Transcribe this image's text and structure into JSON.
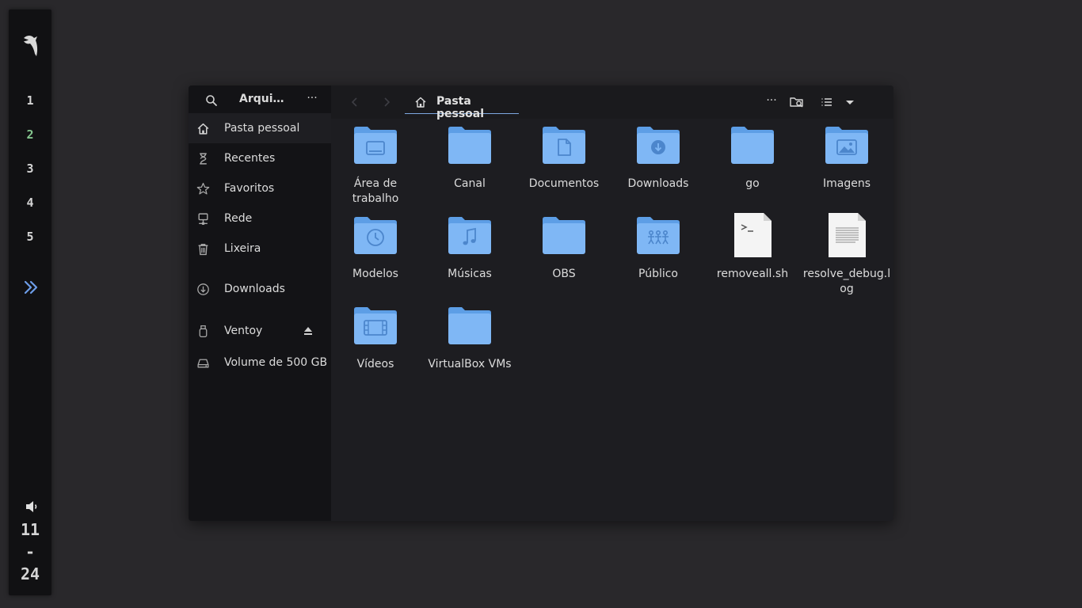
{
  "panel": {
    "workspaces": [
      "1",
      "2",
      "3",
      "4",
      "5"
    ],
    "active_workspace": "2",
    "clock": {
      "hour": "11",
      "sep": "-",
      "minute": "24"
    }
  },
  "window": {
    "sidebar": {
      "title": "Arqui…",
      "menu_label": "···",
      "places": [
        {
          "label": "Pasta pessoal",
          "icon": "home-icon",
          "selected": true
        },
        {
          "label": "Recentes",
          "icon": "hourglass-icon"
        },
        {
          "label": "Favoritos",
          "icon": "star-icon"
        },
        {
          "label": "Rede",
          "icon": "network-icon"
        },
        {
          "label": "Lixeira",
          "icon": "trash-icon"
        }
      ],
      "bookmarks": [
        {
          "label": "Downloads",
          "icon": "download-icon"
        }
      ],
      "devices": [
        {
          "label": "Ventoy",
          "icon": "usb-drive-icon",
          "ejectable": true
        },
        {
          "label": "Volume de 500 GB",
          "icon": "disk-icon"
        }
      ]
    },
    "header": {
      "location": "Pasta pessoal",
      "menu_label": "···"
    },
    "items": [
      {
        "name": "Área de trabalho",
        "type": "folder",
        "emblem": "desktop"
      },
      {
        "name": "Canal",
        "type": "folder",
        "emblem": "none"
      },
      {
        "name": "Documentos",
        "type": "folder",
        "emblem": "document"
      },
      {
        "name": "Downloads",
        "type": "folder",
        "emblem": "download"
      },
      {
        "name": "go",
        "type": "folder",
        "emblem": "none"
      },
      {
        "name": "Imagens",
        "type": "folder",
        "emblem": "image"
      },
      {
        "name": "Modelos",
        "type": "folder",
        "emblem": "clock"
      },
      {
        "name": "Músicas",
        "type": "folder",
        "emblem": "music"
      },
      {
        "name": "OBS",
        "type": "folder",
        "emblem": "none"
      },
      {
        "name": "Público",
        "type": "folder",
        "emblem": "people"
      },
      {
        "name": "removeall.sh",
        "type": "script"
      },
      {
        "name": "resolve_debug.log",
        "type": "text"
      },
      {
        "name": "Vídeos",
        "type": "folder",
        "emblem": "video"
      },
      {
        "name": "VirtualBox VMs",
        "type": "folder",
        "emblem": "none"
      }
    ],
    "colors": {
      "folder": "#7fb7f5",
      "folder_back": "#5d9ee6",
      "emblem": "#4c86cc",
      "accent": "#7da8e0"
    }
  }
}
